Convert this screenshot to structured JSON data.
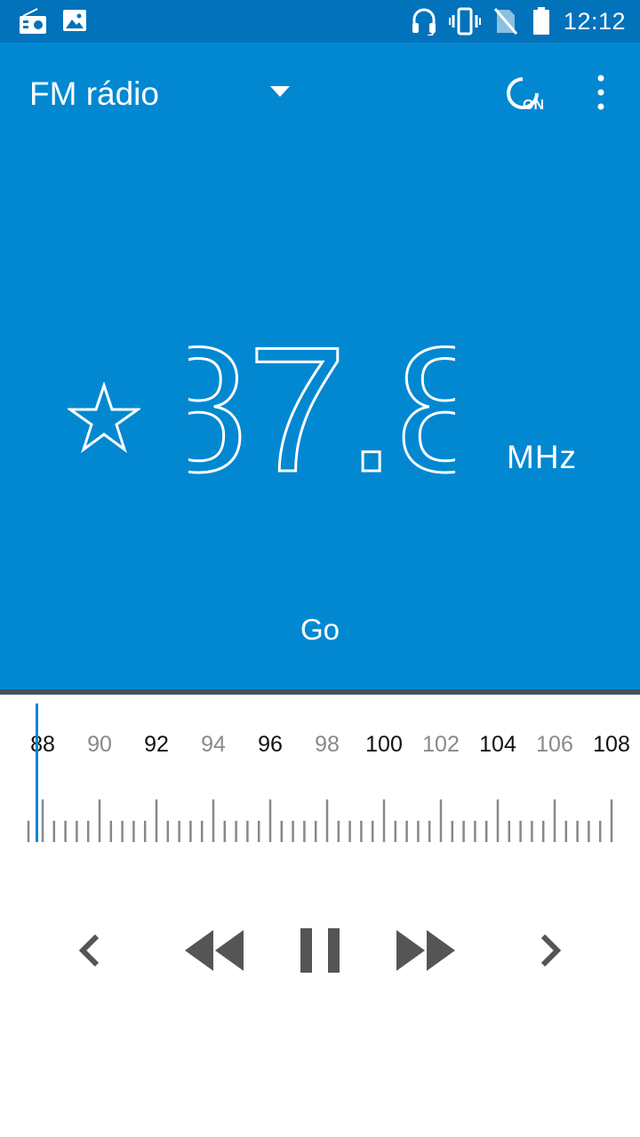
{
  "status_bar": {
    "time": "12:12",
    "icons": [
      "radio-icon",
      "image-icon",
      "headset-icon",
      "vibrate-icon",
      "no-sim-icon",
      "battery-icon"
    ]
  },
  "app_bar": {
    "title": "FM rádio",
    "icons": [
      "dropdown-arrow-icon",
      "power-on-icon",
      "more-vert-icon"
    ],
    "power_badge": "ON"
  },
  "tuner": {
    "frequency": "87.8",
    "unit": "MHz",
    "favorite_icon": "star-outline-icon",
    "station_name": "Go"
  },
  "dial": {
    "labels": [
      "88",
      "90",
      "92",
      "94",
      "96",
      "98",
      "100",
      "102",
      "104",
      "106",
      "108"
    ],
    "min": 87.8,
    "max": 108,
    "needle_value": 87.8
  },
  "controls": [
    "prev-arrow-icon",
    "rewind-icon",
    "pause-icon",
    "fast-forward-icon",
    "next-arrow-icon"
  ],
  "colors": {
    "status_bar": "#0272ba",
    "accent": "#0288d1",
    "divider": "#45525f",
    "control_gray": "#555555"
  }
}
